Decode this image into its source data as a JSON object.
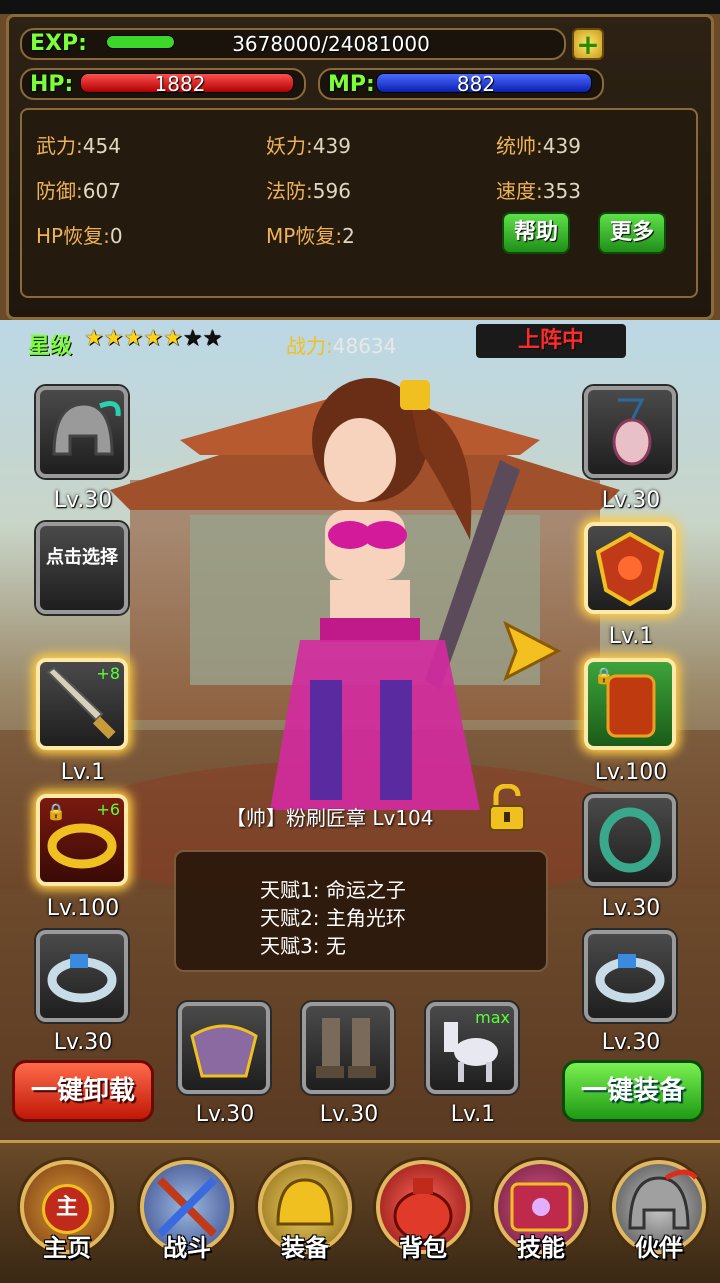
{
  "exp": {
    "label": "EXP:",
    "value": "3678000/24081000",
    "progress": 0.153
  },
  "hp": {
    "label": "HP:",
    "value": "1882",
    "progress": 1.0
  },
  "mp": {
    "label": "MP:",
    "value": "882",
    "progress": 1.0
  },
  "stats": [
    {
      "key": "武力:",
      "val": "454"
    },
    {
      "key": "妖力:",
      "val": "439"
    },
    {
      "key": "统帅:",
      "val": "439"
    },
    {
      "key": "防御:",
      "val": "607"
    },
    {
      "key": "法防:",
      "val": "596"
    },
    {
      "key": "速度:",
      "val": "353"
    },
    {
      "key": "HP恢复:",
      "val": "0"
    },
    {
      "key": "MP恢复:",
      "val": "2"
    }
  ],
  "buttons": {
    "help": "帮助",
    "more": "更多",
    "unload_all": "一键卸载",
    "equip_all": "一键装备"
  },
  "rank": {
    "label": "星级",
    "stars_filled": 5,
    "stars_total": 7,
    "power_label": "战力:",
    "power_value": "48634",
    "status": "上阵中"
  },
  "left_slots": [
    {
      "name": "helmet",
      "level": "Lv.30"
    },
    {
      "name": "select",
      "text": "点击选择"
    },
    {
      "name": "dagger",
      "level": "Lv.1",
      "plus": "+8"
    },
    {
      "name": "gold-bracelet",
      "level": "Lv.100",
      "plus": "+6"
    },
    {
      "name": "ring",
      "level": "Lv.30"
    }
  ],
  "right_slots": [
    {
      "name": "amulet",
      "level": "Lv.30"
    },
    {
      "name": "shield-emblem",
      "level": "Lv.1"
    },
    {
      "name": "armor",
      "level": "Lv.100"
    },
    {
      "name": "jade-ring",
      "level": "Lv.30"
    },
    {
      "name": "ring",
      "level": "Lv.30"
    }
  ],
  "bottom_slots": [
    {
      "name": "shoulder-armor",
      "level": "Lv.30"
    },
    {
      "name": "boots",
      "level": "Lv.30"
    },
    {
      "name": "horse",
      "level": "Lv.1",
      "badge": "max"
    }
  ],
  "hero": {
    "name": "【帅】粉刷匠章 Lv104"
  },
  "talents": [
    "天赋1: 命运之子",
    "天赋2: 主角光环",
    "天赋3: 无"
  ],
  "nav": [
    "主页",
    "战斗",
    "装备",
    "背包",
    "技能",
    "伙伴"
  ],
  "nav_home_badge": "主",
  "colors": {
    "exp": "#3dd62a",
    "hp": "#e01818",
    "mp": "#1a3fe0",
    "accent": "#7cff3a"
  }
}
